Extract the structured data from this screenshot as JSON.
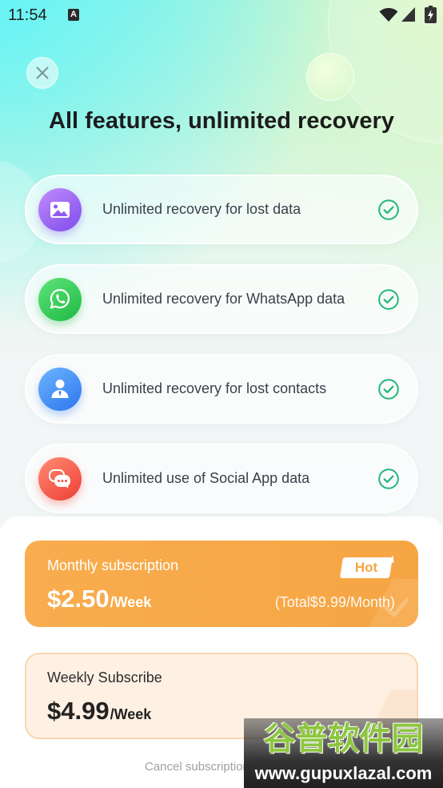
{
  "status_bar": {
    "time": "11:54",
    "notification_letter": "A",
    "icons": [
      "wifi-icon",
      "signal-icon",
      "battery-charging-icon"
    ]
  },
  "header": {
    "close_icon": "close-icon",
    "title": "All features, unlimited recovery"
  },
  "features": [
    {
      "icon": "image-icon",
      "label": "Unlimited recovery for lost data",
      "status_icon": "check-circle-icon"
    },
    {
      "icon": "whatsapp-icon",
      "label": "Unlimited recovery for WhatsApp data",
      "status_icon": "check-circle-icon"
    },
    {
      "icon": "contact-icon",
      "label": "Unlimited recovery for lost contacts",
      "status_icon": "check-circle-icon"
    },
    {
      "icon": "chat-icon",
      "label": "Unlimited use of Social App data",
      "status_icon": "check-circle-icon"
    }
  ],
  "plans": [
    {
      "name": "Monthly subscription",
      "price": "$2.50",
      "unit": "/Week",
      "badge": "Hot",
      "total": "(Total$9.99/Month)",
      "selected": true
    },
    {
      "name": "Weekly Subscribe",
      "price": "$4.99",
      "unit": "/Week",
      "selected": false
    }
  ],
  "footer": {
    "cancel_text": "Cancel subscription"
  },
  "watermark": {
    "brand": "谷普软件园",
    "url": "www.gupuxlazal.com"
  },
  "colors": {
    "accent_orange": "#F6A543",
    "check_green": "#21B67B",
    "weekly_bg": "#FEF0E3",
    "weekly_border": "#F9D5B0",
    "icon_purple": "#8E5CF0",
    "icon_green": "#2BC24C",
    "icon_blue": "#3A86F3",
    "icon_red": "#F2503F",
    "title_text": "#1C1C1C"
  }
}
